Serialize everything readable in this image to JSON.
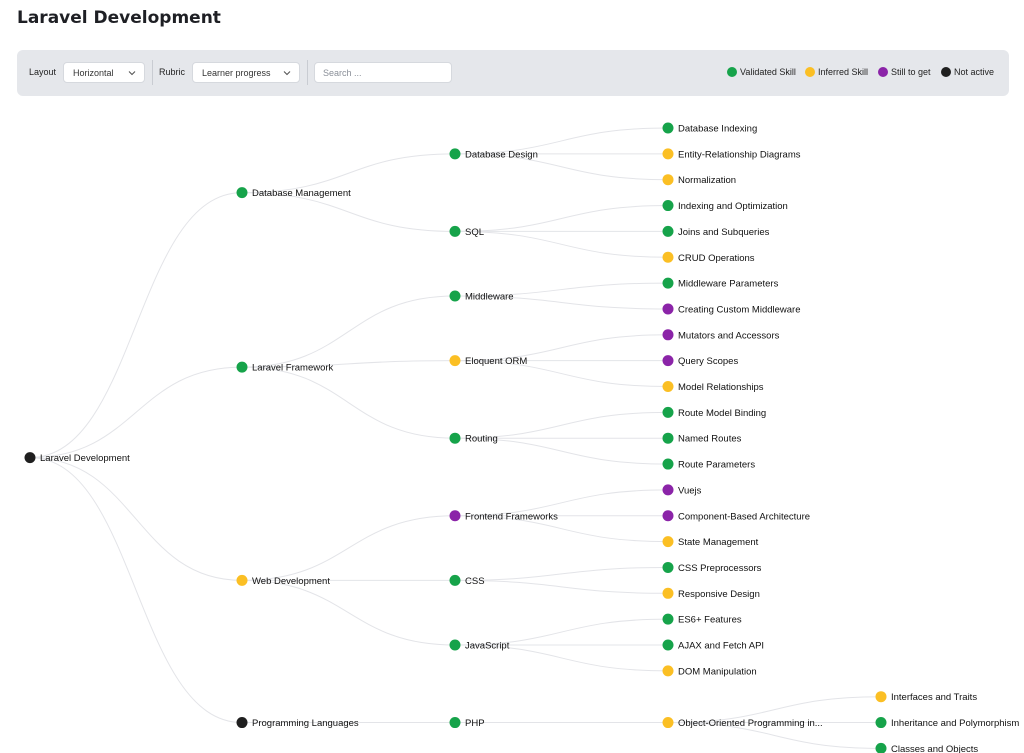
{
  "page": {
    "title": "Laravel Development"
  },
  "toolbar": {
    "layout_label": "Layout",
    "layout_value": "Horizontal",
    "rubric_label": "Rubric",
    "rubric_value": "Learner progress",
    "search_placeholder": "Search ...",
    "search_value": ""
  },
  "legend": [
    {
      "key": "validated",
      "label": "Validated Skill",
      "color": "#16a34a"
    },
    {
      "key": "inferred",
      "label": "Inferred Skill",
      "color": "#fbbf24"
    },
    {
      "key": "still",
      "label": "Still to get",
      "color": "#8b24a8"
    },
    {
      "key": "inactive",
      "label": "Not active",
      "color": "#1f1f1f"
    }
  ],
  "tree": {
    "label": "Laravel Development",
    "status": "inactive",
    "children": [
      {
        "label": "Database Management",
        "status": "validated",
        "children": [
          {
            "label": "Database Design",
            "status": "validated",
            "children": [
              {
                "label": "Database Indexing",
                "status": "validated"
              },
              {
                "label": "Entity-Relationship Diagrams",
                "status": "inferred"
              },
              {
                "label": "Normalization",
                "status": "inferred"
              }
            ]
          },
          {
            "label": "SQL",
            "status": "validated",
            "children": [
              {
                "label": "Indexing and Optimization",
                "status": "validated"
              },
              {
                "label": "Joins and Subqueries",
                "status": "validated"
              },
              {
                "label": "CRUD Operations",
                "status": "inferred"
              }
            ]
          }
        ]
      },
      {
        "label": "Laravel Framework",
        "status": "validated",
        "children": [
          {
            "label": "Middleware",
            "status": "validated",
            "children": [
              {
                "label": "Middleware Parameters",
                "status": "validated"
              },
              {
                "label": "Creating Custom Middleware",
                "status": "still"
              }
            ]
          },
          {
            "label": "Eloquent ORM",
            "status": "inferred",
            "children": [
              {
                "label": "Mutators and Accessors",
                "status": "still"
              },
              {
                "label": "Query Scopes",
                "status": "still"
              },
              {
                "label": "Model Relationships",
                "status": "inferred"
              }
            ]
          },
          {
            "label": "Routing",
            "status": "validated",
            "children": [
              {
                "label": "Route Model Binding",
                "status": "validated"
              },
              {
                "label": "Named Routes",
                "status": "validated"
              },
              {
                "label": "Route Parameters",
                "status": "validated"
              }
            ]
          }
        ]
      },
      {
        "label": "Web Development",
        "status": "inferred",
        "children": [
          {
            "label": "Frontend Frameworks",
            "status": "still",
            "children": [
              {
                "label": "Vuejs",
                "status": "still"
              },
              {
                "label": "Component-Based Architecture",
                "status": "still"
              },
              {
                "label": "State Management",
                "status": "inferred"
              }
            ]
          },
          {
            "label": "CSS",
            "status": "validated",
            "children": [
              {
                "label": "CSS Preprocessors",
                "status": "validated"
              },
              {
                "label": "Responsive Design",
                "status": "inferred"
              }
            ]
          },
          {
            "label": "JavaScript",
            "status": "validated",
            "children": [
              {
                "label": "ES6+ Features",
                "status": "validated"
              },
              {
                "label": "AJAX and Fetch API",
                "status": "validated"
              },
              {
                "label": "DOM Manipulation",
                "status": "inferred"
              }
            ]
          }
        ]
      },
      {
        "label": "Programming Languages",
        "status": "inactive",
        "children": [
          {
            "label": "PHP",
            "status": "validated",
            "children": [
              {
                "label": "Object-Oriented Programming in...",
                "status": "inferred",
                "children": [
                  {
                    "label": "Interfaces and Traits",
                    "status": "inferred"
                  },
                  {
                    "label": "Inheritance and Polymorphism",
                    "status": "validated"
                  },
                  {
                    "label": "Classes and Objects",
                    "status": "validated"
                  }
                ]
              }
            ]
          }
        ]
      }
    ]
  }
}
